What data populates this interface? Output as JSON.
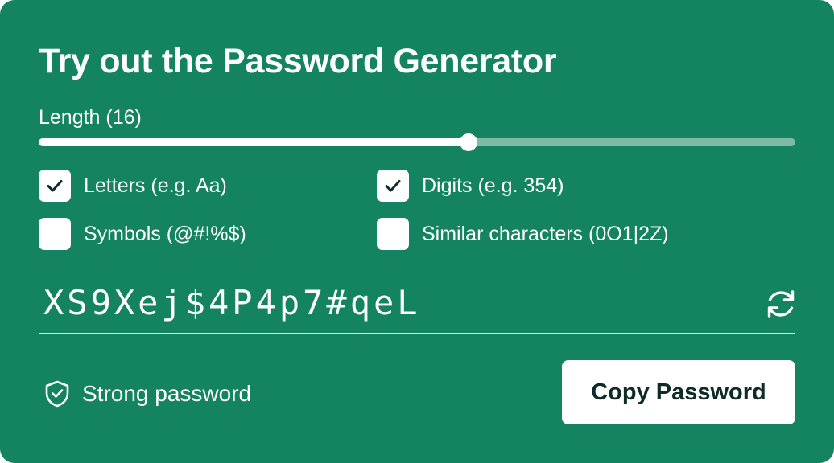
{
  "title": "Try out the Password Generator",
  "length": {
    "label": "Length (16)",
    "value": 16,
    "fill_fraction": 0.568
  },
  "options": {
    "letters": {
      "label": "Letters (e.g. Aa)",
      "checked": true
    },
    "digits": {
      "label": "Digits (e.g. 354)",
      "checked": true
    },
    "symbols": {
      "label": "Symbols (@#!%$)",
      "checked": false
    },
    "similar": {
      "label": "Similar characters (0O1|2Z)",
      "checked": false
    }
  },
  "password": {
    "value": "XS9Xej$4P4p7#qeL",
    "refresh_icon": "refresh-icon"
  },
  "strength": {
    "label": "Strong password",
    "icon": "shield-check-icon"
  },
  "copy_button": {
    "label": "Copy Password"
  },
  "colors": {
    "background": "#13845f",
    "foreground": "#ffffff",
    "button_text": "#0f2a2a"
  }
}
